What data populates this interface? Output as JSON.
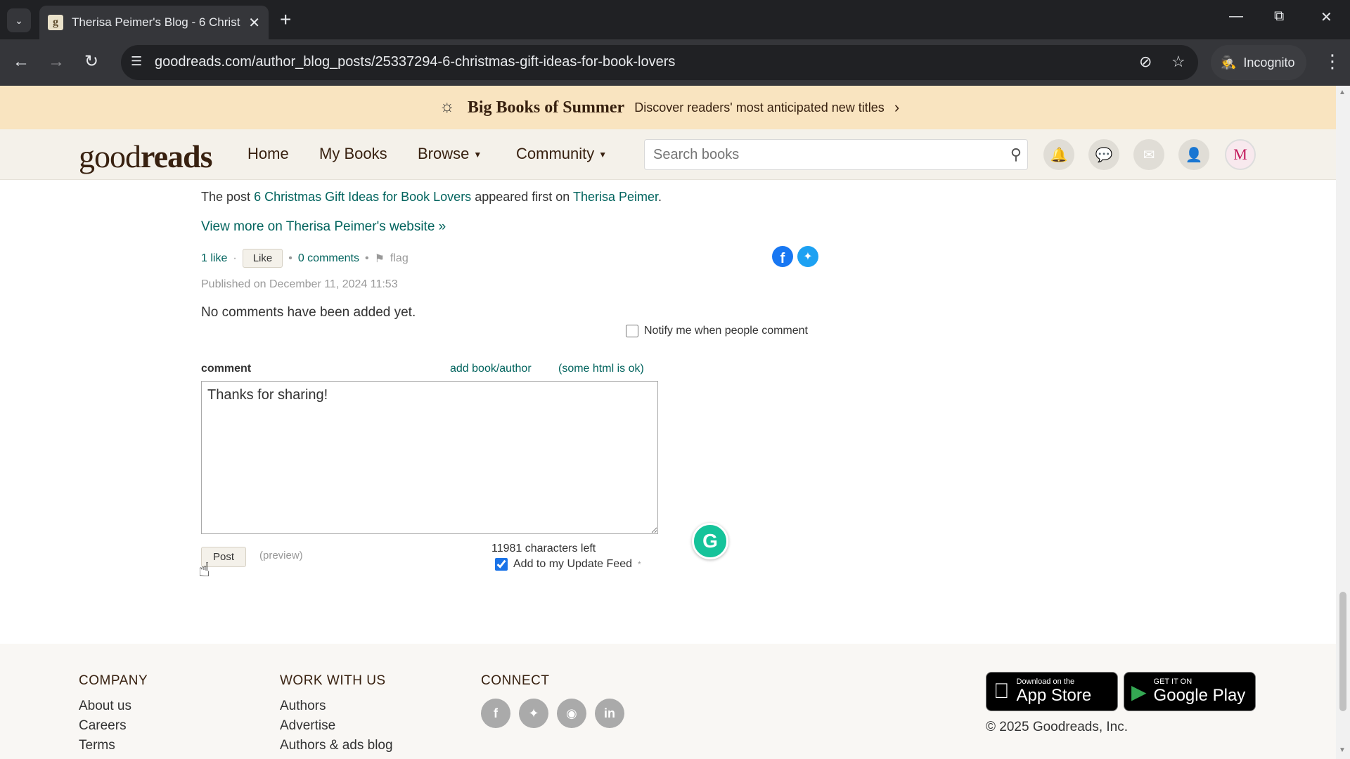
{
  "browser": {
    "tab_title": "Therisa Peimer's Blog - 6 Christ",
    "favicon_letter": "g",
    "url": "goodreads.com/author_blog_posts/25337294-6-christmas-gift-ideas-for-book-lovers",
    "incognito_label": "Incognito"
  },
  "banner": {
    "title": "Big Books of Summer",
    "subtitle": "Discover readers' most anticipated new titles"
  },
  "header": {
    "logo_light": "good",
    "logo_bold": "reads",
    "nav": {
      "home": "Home",
      "my_books": "My Books",
      "browse": "Browse",
      "community": "Community"
    },
    "search_placeholder": "Search books",
    "avatar_letter": "M"
  },
  "post": {
    "line_prefix": "The post",
    "post_link": "6 Christmas Gift Ideas for Book Lovers",
    "line_middle": "appeared first on",
    "author_link": "Therisa Peimer",
    "line_suffix": ".",
    "view_more": "View more on Therisa Peimer's website »",
    "likes": "1 like",
    "like_button": "Like",
    "comments_link": "0 comments",
    "flag": "flag",
    "published": "Published on December 11, 2024 11:53",
    "no_comments": "No comments have been added yet.",
    "notify_label": "Notify me when people comment"
  },
  "comment_form": {
    "label": "comment",
    "add_book_author": "add book/author",
    "html_ok": "(some html is ok)",
    "text": "Thanks for sharing!",
    "post_button": "Post",
    "preview": "(preview)",
    "chars_left": "11981 characters left",
    "update_feed_label": "Add to my Update Feed",
    "update_feed_checked": true,
    "notify_checked": false
  },
  "footer": {
    "company": {
      "heading": "COMPANY",
      "links": [
        "About us",
        "Careers",
        "Terms"
      ]
    },
    "work": {
      "heading": "WORK WITH US",
      "links": [
        "Authors",
        "Advertise",
        "Authors & ads blog"
      ]
    },
    "connect": {
      "heading": "CONNECT"
    },
    "app_store": {
      "small": "Download on the",
      "big": "App Store"
    },
    "google_play": {
      "small": "GET IT ON",
      "big": "Google Play"
    },
    "copyright": "© 2025 Goodreads, Inc."
  },
  "colors": {
    "link_green": "#00635d",
    "banner_bg": "#f9e4c0",
    "header_bg": "#f4f1ea",
    "brand_brown": "#382110"
  }
}
